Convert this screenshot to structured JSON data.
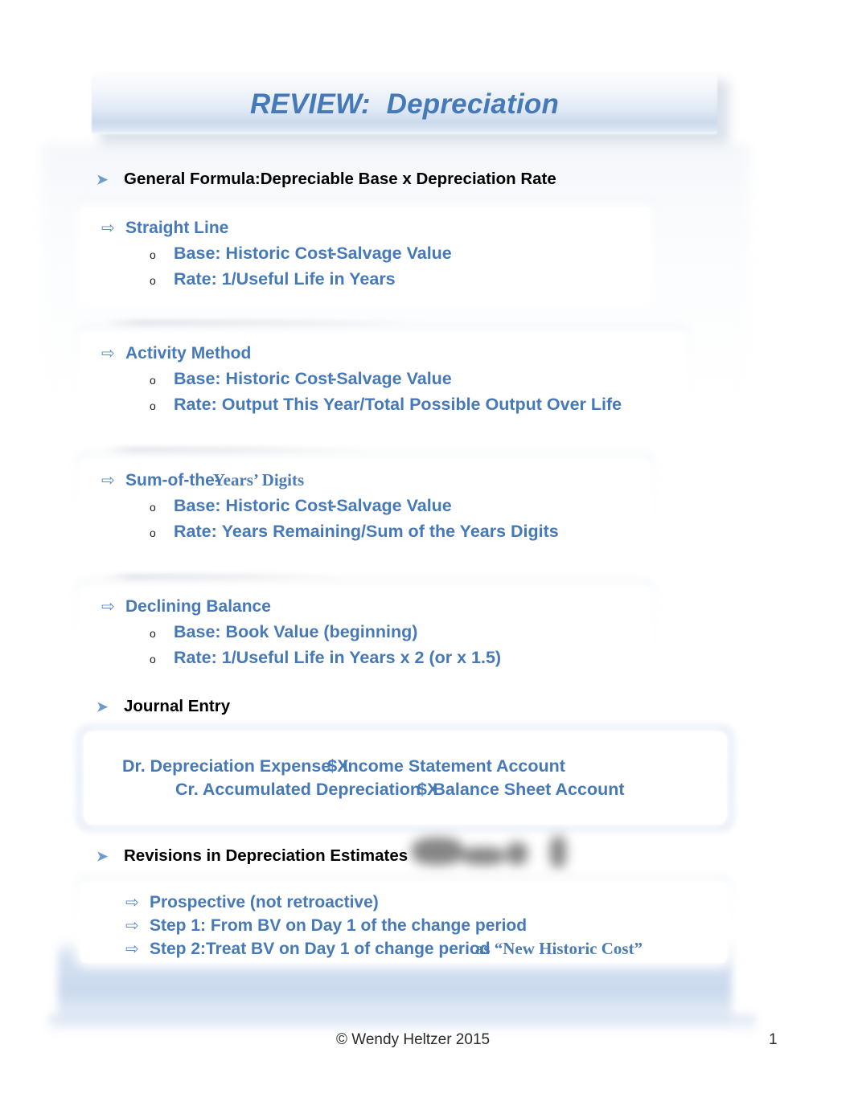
{
  "slide": {
    "title": "REVIEW:  Depreciation",
    "accent_blue": "#4679b8",
    "heading_black": "#000000"
  },
  "bullets": {
    "level1_glyph": "➤",
    "level2_glyph": "⇨",
    "level3_glyph": "o"
  },
  "sections": [
    {
      "heading": "General Formula:Depreciable Base x Depreciation Rate",
      "methods": []
    }
  ],
  "methods": [
    {
      "name": "Straight Line",
      "base_label": "Base:",
      "base_value_a": "Historic Cost",
      "base_minus": "-",
      "base_value_b": "Salvage Value",
      "rate_label": "Rate:",
      "rate_value": "1/Useful Life in Years"
    },
    {
      "name": "Activity Method",
      "base_label": "Base:",
      "base_value_a": "Historic Cost",
      "base_minus": "-",
      "base_value_b": "Salvage Value",
      "rate_label": "Rate:",
      "rate_value": "Output This Year/Total Possible Output Over Life"
    },
    {
      "name_sans": "Sum-of-the-",
      "name_serif": "Years’ Digits",
      "base_label": "Base:",
      "base_value_a": "Historic Cost",
      "base_minus": "-",
      "base_value_b": "Salvage Value",
      "rate_label": "Rate:",
      "rate_value": "Years Remaining/Sum of the Years Digits"
    },
    {
      "name": "Declining Balance",
      "base_label": "Base:",
      "base_value_a": "Book Value (beginning)",
      "rate_label": "Rate:",
      "rate_value": "1/Useful Life in Years x 2 (or x 1.5)"
    }
  ],
  "journal_entry": {
    "heading": "Journal Entry",
    "debit_account": "Dr. Depreciation Expense ",
    "debit_amount": "$X",
    "debit_note": "Income Statement Account",
    "credit_account": "Cr. Accumulated Depreciation ",
    "credit_amount": "$X",
    "credit_note": "Balance Sheet Account"
  },
  "revisions": {
    "heading": "Revisions in Depreciation Estimates",
    "items": [
      "Prospective (not retroactive)",
      "Step 1: From BV on Day 1 of the change period"
    ],
    "step2_sans": "Step 2:Treat BV on Day 1 of change period",
    "step2_serif": " as “New Historic Cost”"
  },
  "footer": {
    "copyright": "© Wendy Heltzer 2015",
    "page_number": "1"
  }
}
